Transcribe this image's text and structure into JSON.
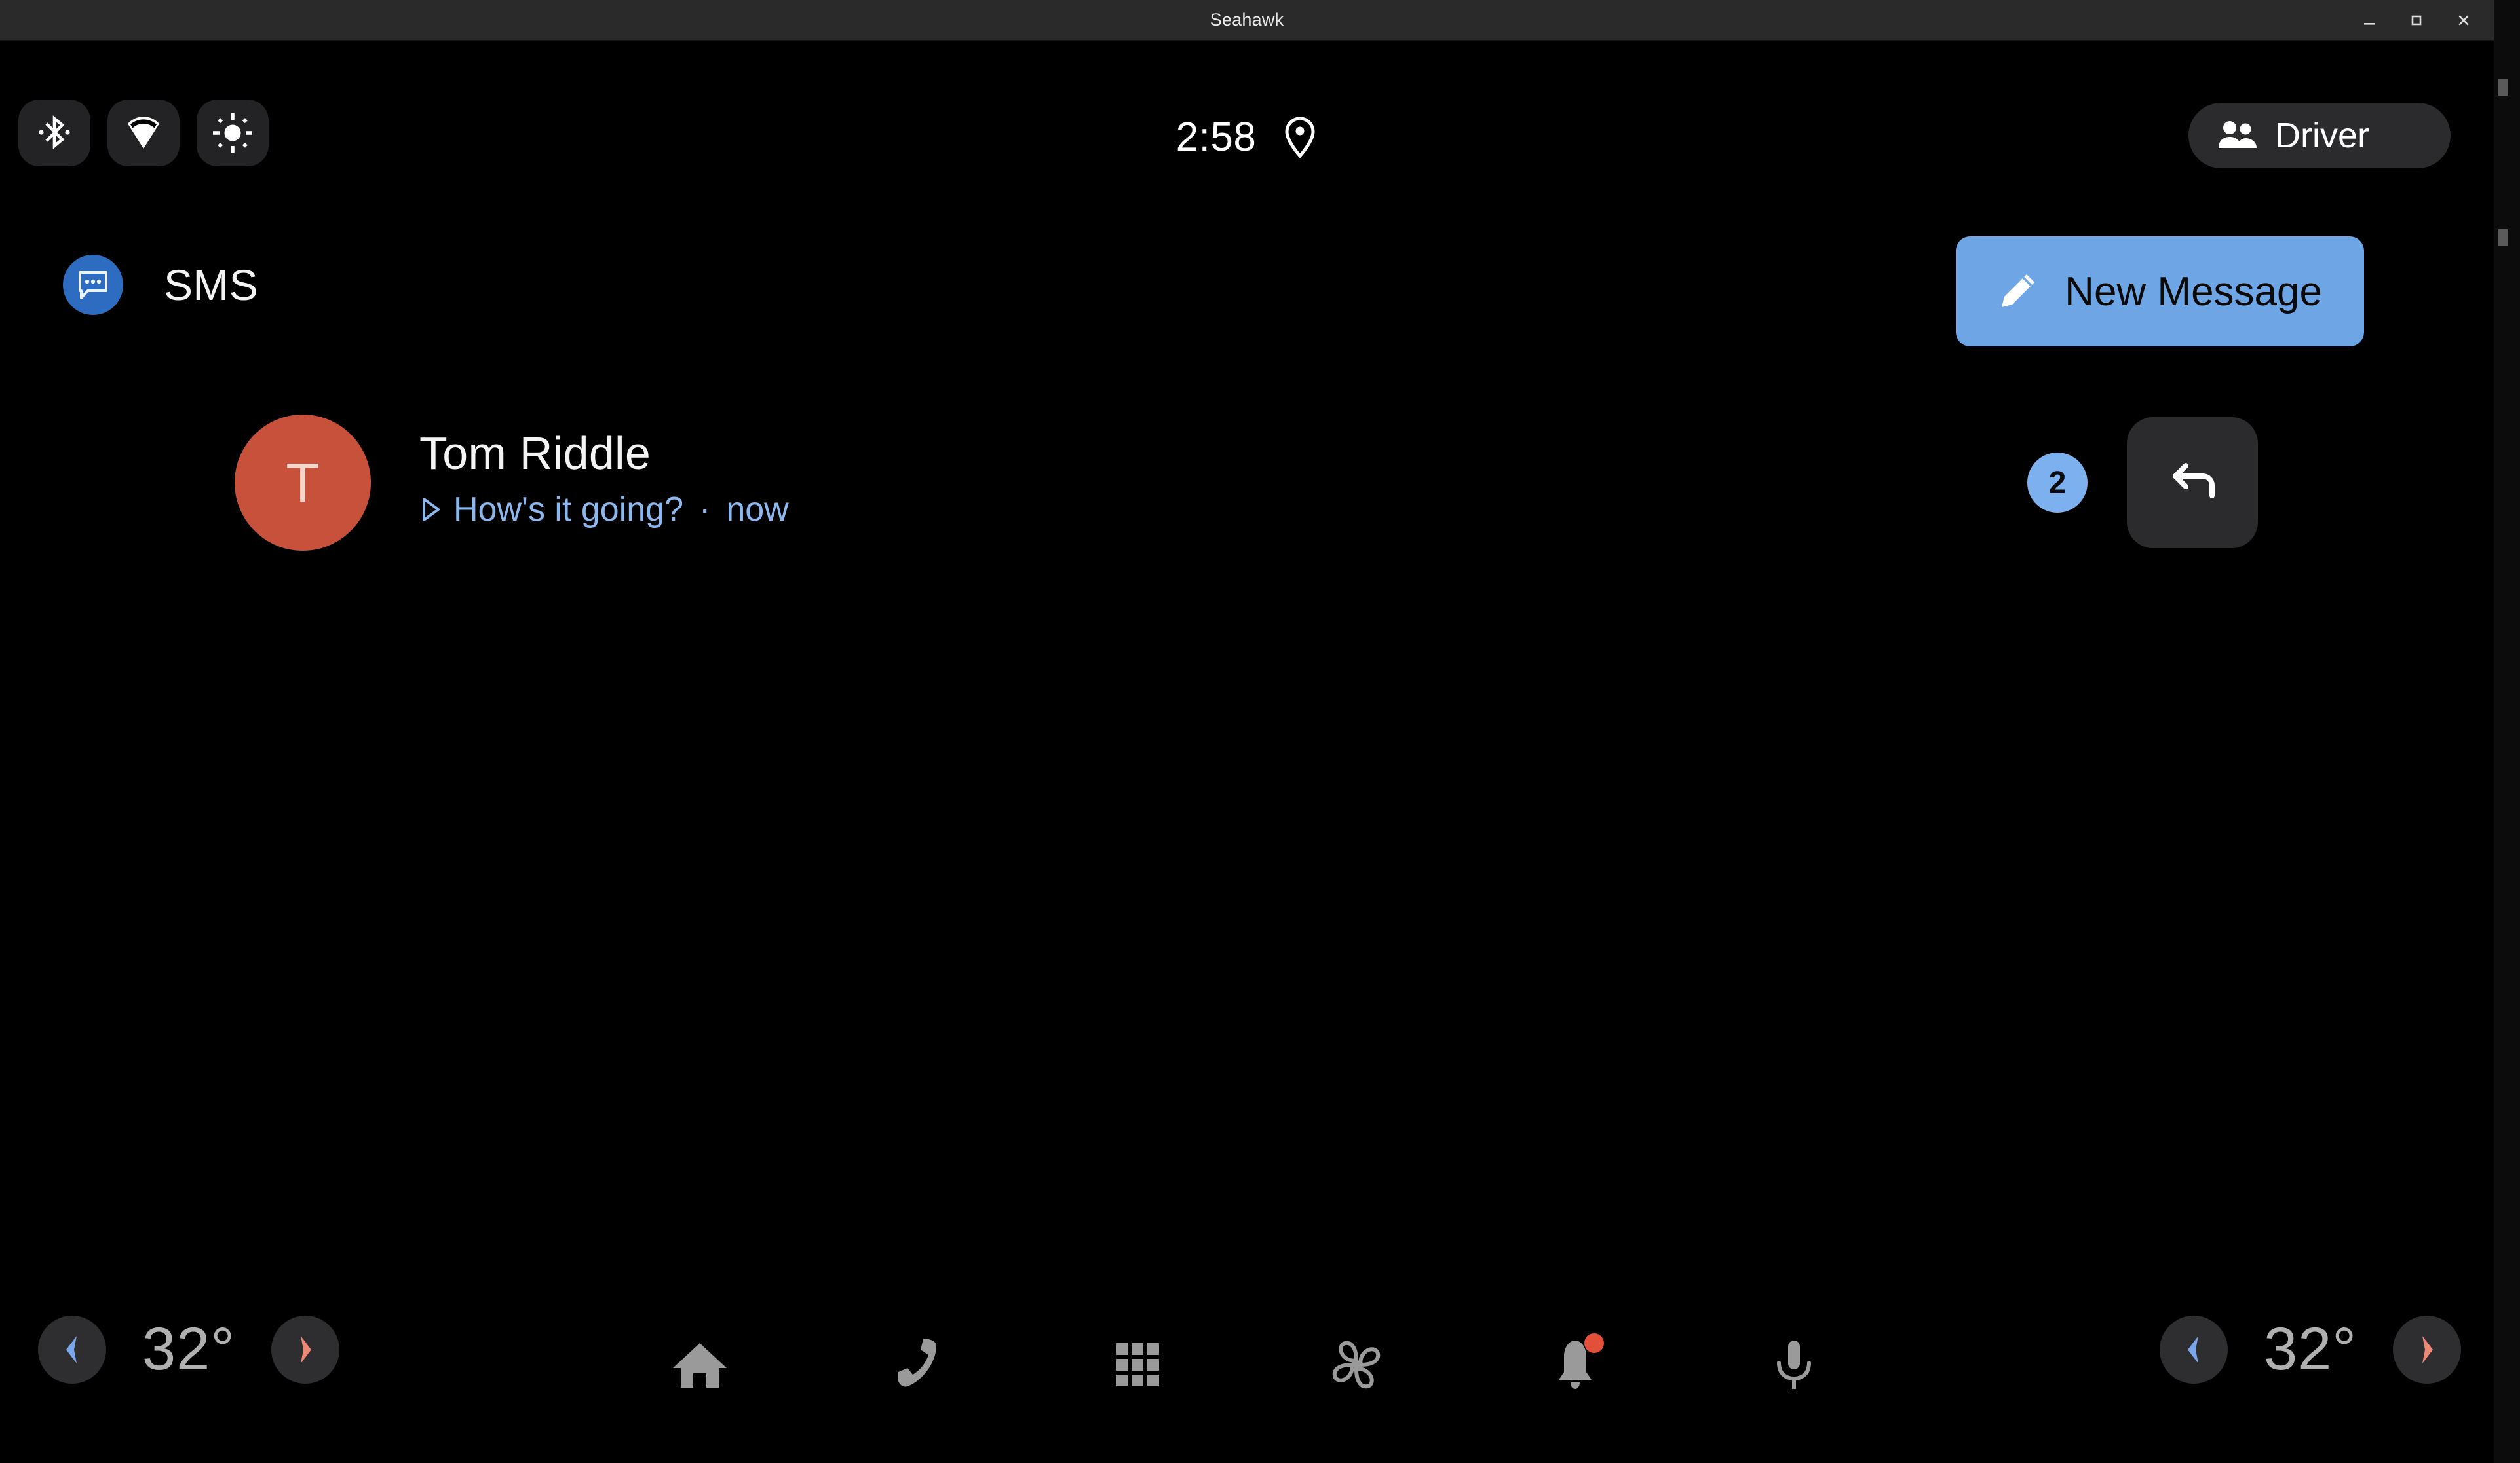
{
  "window": {
    "title": "Seahawk",
    "controls": [
      {
        "name": "minimize",
        "glyph": "minimize-icon"
      },
      {
        "name": "maximize",
        "glyph": "maximize-icon"
      },
      {
        "name": "close",
        "glyph": "close-icon"
      }
    ]
  },
  "statusbar": {
    "quick_toggles": [
      {
        "name": "bluetooth",
        "icon": "bluetooth-icon"
      },
      {
        "name": "wifi",
        "icon": "wifi-icon"
      },
      {
        "name": "brightness",
        "icon": "brightness-icon"
      }
    ],
    "clock": "2:58",
    "location_icon": "location-pin-icon",
    "profile": {
      "label": "Driver",
      "icon": "people-icon"
    }
  },
  "app": {
    "icon": "sms-chat-bubble-icon",
    "title": "SMS",
    "new_message": {
      "label": "New Message",
      "icon": "pencil-icon"
    }
  },
  "conversations": [
    {
      "avatar_initial": "T",
      "avatar_color": "#c8513c",
      "name": "Tom Riddle",
      "snippet": "How's it going?",
      "separator": "·",
      "time": "now",
      "unread_count": "2",
      "play_icon": "play-triangle-icon",
      "reply_icon": "reply-arrow-icon"
    }
  ],
  "navbar": {
    "temp_left": {
      "value": "32°",
      "decrease_icon": "chevron-left-icon",
      "increase_icon": "chevron-right-icon"
    },
    "temp_right": {
      "value": "32°",
      "decrease_icon": "chevron-left-icon",
      "increase_icon": "chevron-right-icon"
    },
    "items": [
      {
        "name": "home",
        "icon": "home-icon",
        "badge": false
      },
      {
        "name": "phone",
        "icon": "phone-icon",
        "badge": false
      },
      {
        "name": "apps",
        "icon": "apps-grid-icon",
        "badge": false
      },
      {
        "name": "climate",
        "icon": "fan-icon",
        "badge": false
      },
      {
        "name": "notifications",
        "icon": "bell-icon",
        "badge": true
      },
      {
        "name": "assistant",
        "icon": "microphone-icon",
        "badge": false
      }
    ]
  },
  "colors": {
    "accent_blue": "#6ea5e4",
    "badge_blue": "#7cb0ee",
    "link_blue": "#8cb8f0",
    "avatar_red": "#c8513c",
    "notification_red": "#e3503a",
    "surface": "#232326",
    "background": "#000000"
  }
}
